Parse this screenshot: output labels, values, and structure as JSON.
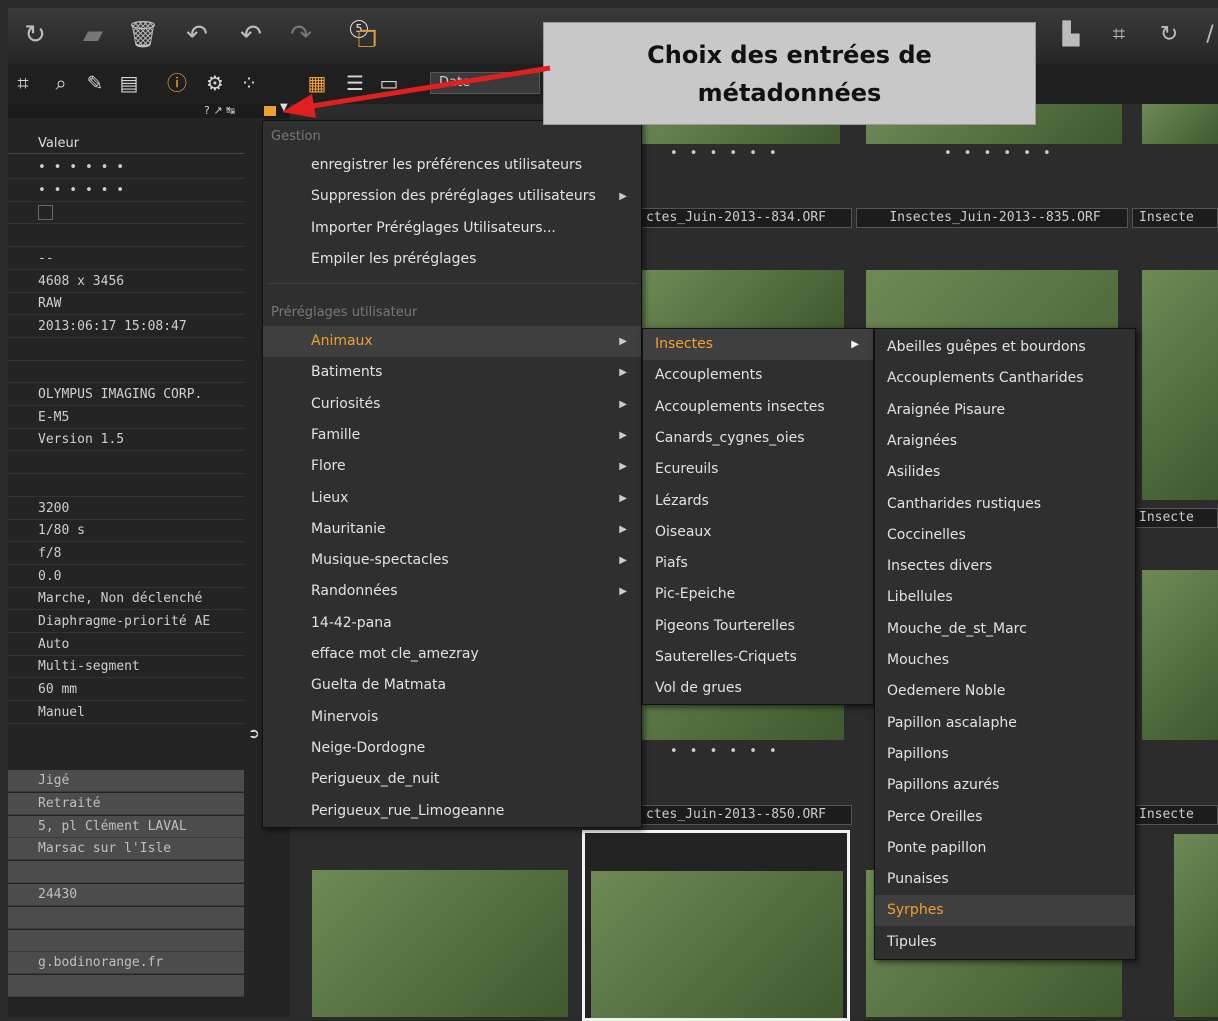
{
  "callout": {
    "line1": "Choix des entrées de",
    "line2": "métadonnées"
  },
  "toolbar": {
    "badge": "5",
    "date_label": "Date"
  },
  "left_panel": {
    "minitools": "? ↗ ↹",
    "header": "Valeur",
    "rows": [
      "• • • • • •",
      "• • • • • •",
      "",
      "",
      "--",
      "4608 x 3456",
      "RAW",
      "2013:06:17 15:08:47",
      "",
      "",
      "OLYMPUS IMAGING CORP.",
      "E-M5",
      "Version 1.5",
      "",
      "",
      "3200",
      "1/80 s",
      "f/8",
      "0.0",
      "Marche, Non déclenché",
      "Diaphragme-priorité AE",
      "Auto",
      "Multi-segment",
      "60 mm",
      "Manuel"
    ],
    "iptc_rows": [
      "Jigé",
      "Retraité",
      "5, pl Clément LAVAL",
      "Marsac sur l'Isle",
      "",
      "24430",
      "",
      "",
      "g.bodinorange.fr",
      ""
    ]
  },
  "grid": {
    "file1": "ctes_Juin-2013--834.ORF",
    "file2": "Insectes_Juin-2013--835.ORF",
    "file3": "Insecte",
    "file4": "ctes_Juin-2013--850.ORF",
    "file5": "Insecte",
    "file6": "Insecte",
    "dots": "• • • • • •"
  },
  "menu1": {
    "section1": "Gestion",
    "manage": [
      "enregistrer les préférences utilisateurs",
      "Suppression des préréglages utilisateurs",
      "Importer Préréglages Utilisateurs...",
      "Empiler les préréglages"
    ],
    "section2": "Préréglages utilisateur",
    "presets": [
      "Animaux",
      "Batiments",
      "Curiosités",
      "Famille",
      "Flore",
      "Lieux",
      "Mauritanie",
      "Musique-spectacles",
      "Randonnées",
      "14-42-pana",
      "efface mot cle_amezray",
      "Guelta de Matmata",
      "Minervois",
      "Neige-Dordogne",
      "Perigueux_de_nuit",
      "Perigueux_rue_Limogeanne"
    ]
  },
  "menu2": [
    "Insectes",
    "Accouplements",
    "Accouplements insectes",
    "Canards_cygnes_oies",
    "Ecureuils",
    "Lézards",
    "Oiseaux",
    "Piafs",
    "Pic-Epeiche",
    "Pigeons Tourterelles",
    "Sauterelles-Criquets",
    "Vol de grues"
  ],
  "menu3": [
    "Abeilles guêpes et bourdons",
    "Accouplements Cantharides",
    "Araignée Pisaure",
    "Araignées",
    "Asilides",
    "Cantharides rustiques",
    "Coccinelles",
    "Insectes divers",
    "Libellules",
    "Mouche_de_st_Marc",
    "Mouches",
    "Oedemere Noble",
    "Papillon ascalaphe",
    "Papillons",
    "Papillons azurés",
    "Perce Oreilles",
    "Ponte papillon",
    "Punaises",
    "Syrphes",
    "Tipules"
  ],
  "colors": {
    "highlight": "#f0a030",
    "menu_bg": "#2f2f2f",
    "arrow": "#e02020"
  }
}
